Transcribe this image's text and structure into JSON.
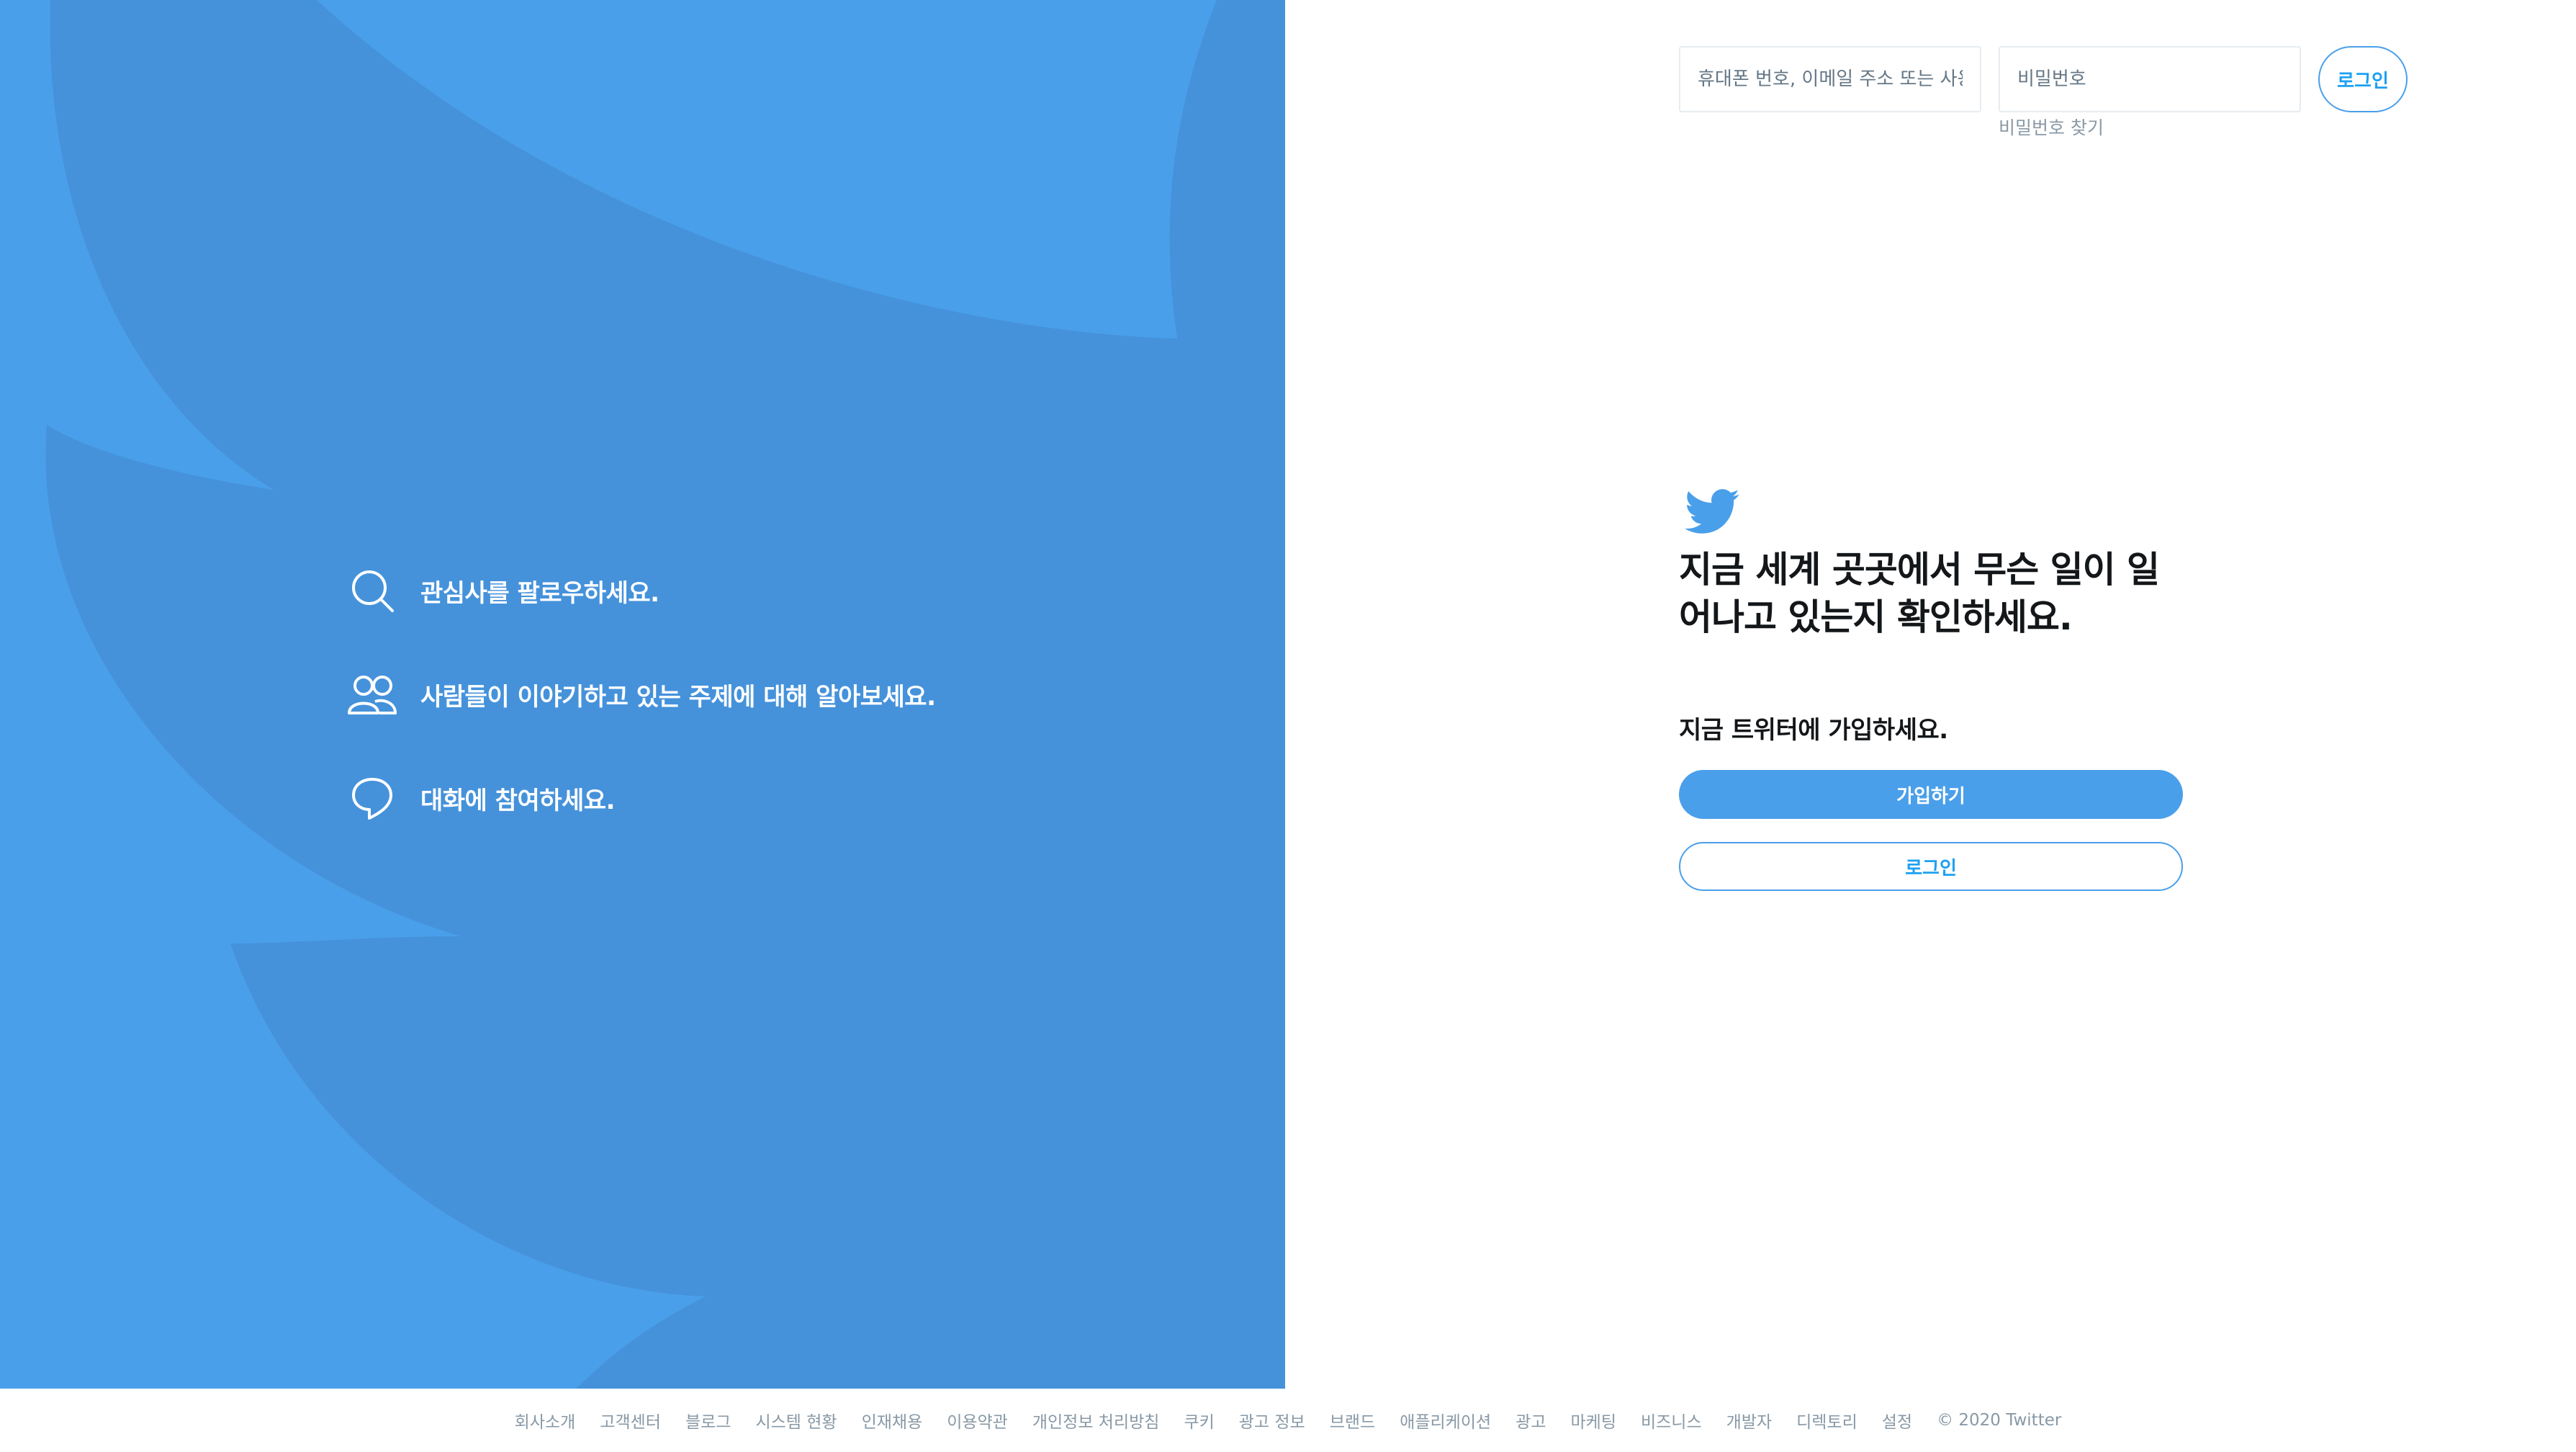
{
  "colors": {
    "brand_blue": "#4a9fea",
    "link_blue": "#1da1f2",
    "text_dark": "#14171a",
    "text_muted": "#8899a6"
  },
  "left_panel": {
    "features": [
      {
        "icon": "search-icon",
        "label": "관심사를 팔로우하세요."
      },
      {
        "icon": "people-icon",
        "label": "사람들이 이야기하고 있는 주제에 대해 알아보세요."
      },
      {
        "icon": "chat-bubble-icon",
        "label": "대화에 참여하세요."
      }
    ]
  },
  "login_bar": {
    "username_placeholder": "휴대폰 번호, 이메일 주소 또는 사용자 아이디",
    "password_placeholder": "비밀번호",
    "forgot_password": "비밀번호 찾기",
    "login_label": "로그인"
  },
  "main": {
    "logo_icon": "twitter-bird-icon",
    "headline": "지금 세계 곳곳에서 무슨 일이 일어나고 있는지 확인하세요.",
    "subhead": "지금 트위터에 가입하세요.",
    "signup_label": "가입하기",
    "login_label": "로그인"
  },
  "footer": {
    "links": [
      "회사소개",
      "고객센터",
      "블로그",
      "시스템 현황",
      "인재채용",
      "이용약관",
      "개인정보 처리방침",
      "쿠키",
      "광고 정보",
      "브랜드",
      "애플리케이션",
      "광고",
      "마케팅",
      "비즈니스",
      "개발자",
      "디렉토리",
      "설정"
    ],
    "copyright": "© 2020 Twitter"
  }
}
